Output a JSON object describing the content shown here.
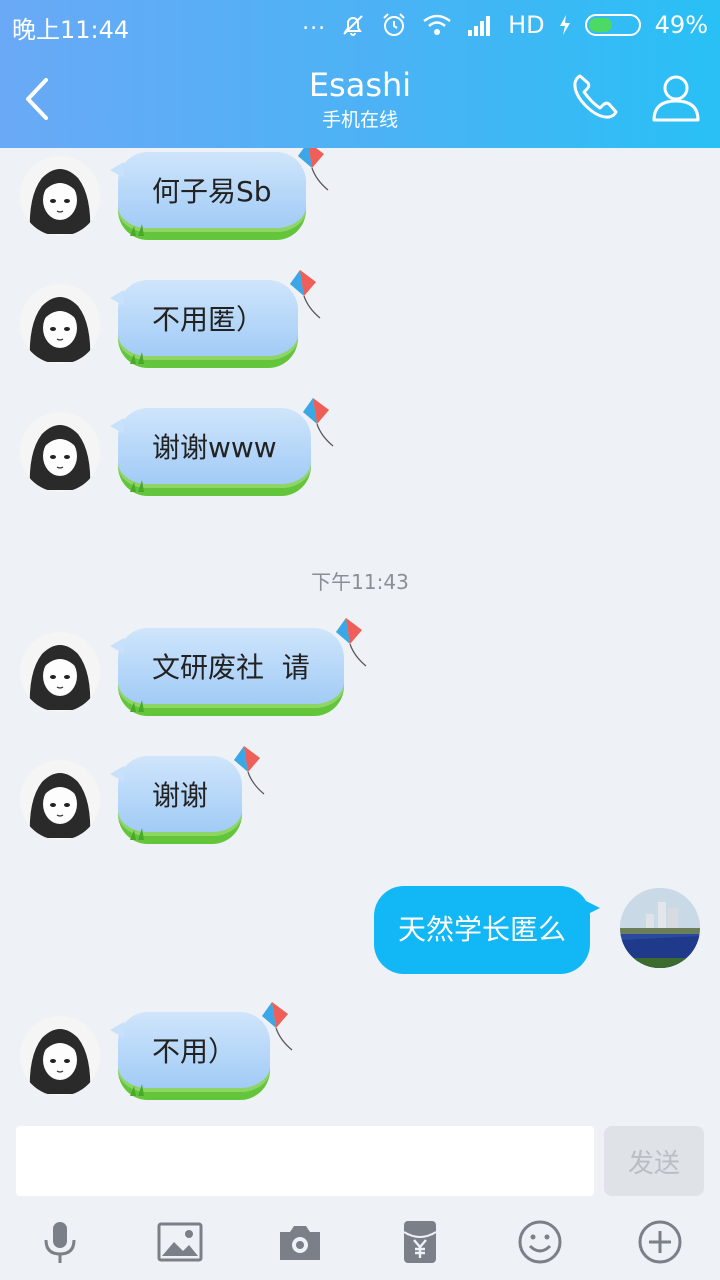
{
  "status_bar": {
    "time": "晚上11:44",
    "dots": "...",
    "network": "HD",
    "battery": "49%",
    "battery_level": 0.49
  },
  "header": {
    "title": "Esashi",
    "subtitle": "手机在线"
  },
  "messages": [
    {
      "from": "them",
      "text": "何子易Sb"
    },
    {
      "from": "them",
      "text": "不用匿）"
    },
    {
      "from": "them",
      "text": "谢谢www"
    },
    {
      "type": "time",
      "text": "下午11:43"
    },
    {
      "from": "them",
      "text": "文研废社  请"
    },
    {
      "from": "them",
      "text": "谢谢"
    },
    {
      "from": "me",
      "text": "天然学长匿么"
    },
    {
      "from": "them",
      "text": "不用）"
    }
  ],
  "input": {
    "placeholder": "",
    "value": "",
    "send_label": "发送"
  },
  "toolbar": {
    "icons": [
      "microphone-icon",
      "image-icon",
      "camera-icon",
      "red-packet-icon",
      "emoji-icon",
      "plus-icon"
    ]
  },
  "colors": {
    "accent": "#12b7f5",
    "header_start": "#6aa9f6",
    "header_end": "#28c0f5"
  }
}
